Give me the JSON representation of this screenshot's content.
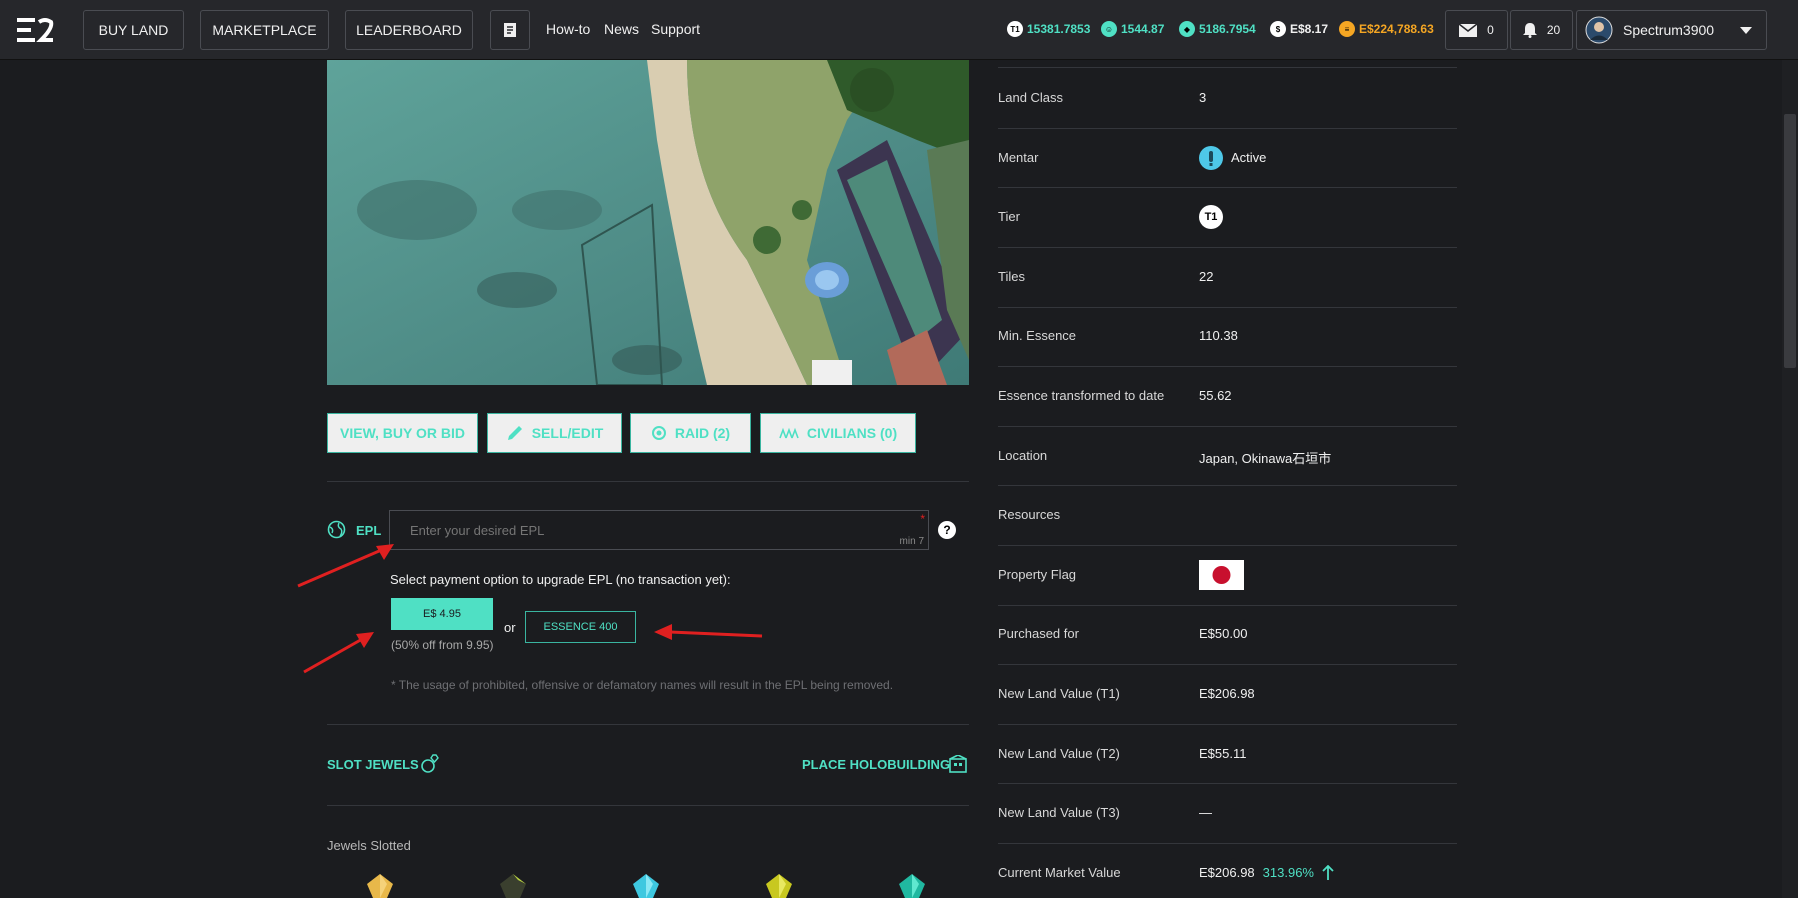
{
  "topbar": {
    "buttons": {
      "buy_land": "BUY LAND",
      "marketplace": "MARKETPLACE",
      "leaderboard": "LEADERBOARD"
    },
    "links": {
      "howto": "How-to",
      "news": "News",
      "support": "Support"
    },
    "stats": {
      "t1": "15381.7853",
      "t1_icon": "T1",
      "civ": "1544.87",
      "essence": "5186.7954",
      "esdollar": "E$8.17",
      "esbalance": "E$224,788.63"
    },
    "mail_count": "0",
    "notif_count": "20",
    "username": "Spectrum3900"
  },
  "actions": {
    "view": "VIEW, BUY OR BID",
    "sell": "SELL/EDIT",
    "raid": "RAID (2)",
    "civilians": "CIVILIANS (0)"
  },
  "epl": {
    "label": "EPL",
    "placeholder": "Enter your desired EPL",
    "required_mark": "*",
    "min_hint": "min 7",
    "help": "?",
    "payment_prompt": "Select payment option to upgrade EPL (no transaction yet):",
    "pay_es": "E$ 4.95",
    "pay_or": "or",
    "pay_essence": "ESSENCE 400",
    "discount": "(50% off from 9.95)",
    "notice": "* The usage of prohibited, offensive or defamatory names will result in the EPL being removed."
  },
  "jewels": {
    "slot": "SLOT JEWELS",
    "place": "PLACE HOLOBUILDING",
    "slotted": "Jewels Slotted"
  },
  "details": [
    {
      "label": "Land Class",
      "value": "3"
    },
    {
      "label": "Mentar",
      "value": "Active"
    },
    {
      "label": "Tier",
      "value": "T1"
    },
    {
      "label": "Tiles",
      "value": "22"
    },
    {
      "label": "Min. Essence",
      "value": "110.38"
    },
    {
      "label": "Essence transformed to date",
      "value": "55.62"
    },
    {
      "label": "Location",
      "value": "Japan, Okinawa石垣市"
    },
    {
      "label": "Resources",
      "value": ""
    },
    {
      "label": "Property Flag",
      "value": ""
    },
    {
      "label": "Purchased for",
      "value": "E$50.00"
    },
    {
      "label": "New Land Value (T1)",
      "value": "E$206.98"
    },
    {
      "label": "New Land Value (T2)",
      "value": "E$55.11"
    },
    {
      "label": "New Land Value (T3)",
      "value": "—"
    },
    {
      "label": "Current Market Value",
      "value": "E$206.98"
    }
  ],
  "market_change": "313.96%",
  "colors": {
    "teal": "#4fe0c4",
    "orange": "#f5a623",
    "red": "#e02020"
  }
}
